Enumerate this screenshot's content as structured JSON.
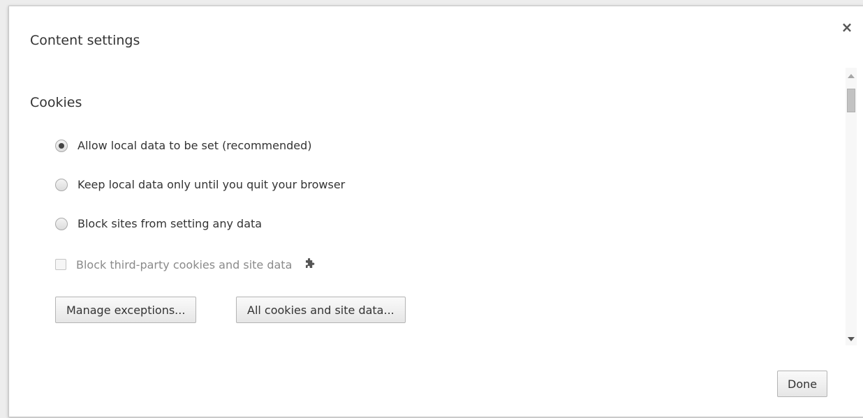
{
  "dialog": {
    "title": "Content settings",
    "close_label": "×"
  },
  "cookies": {
    "section_title": "Cookies",
    "options": [
      {
        "label": "Allow local data to be set (recommended)",
        "selected": true
      },
      {
        "label": "Keep local data only until you quit your browser",
        "selected": false
      },
      {
        "label": "Block sites from setting any data",
        "selected": false
      }
    ],
    "third_party": {
      "label": "Block third-party cookies and site data",
      "checked": false,
      "disabled": true,
      "icon": "puzzle-piece-icon"
    },
    "buttons": {
      "manage_exceptions": "Manage exceptions...",
      "all_cookies": "All cookies and site data..."
    }
  },
  "footer": {
    "done_label": "Done"
  }
}
